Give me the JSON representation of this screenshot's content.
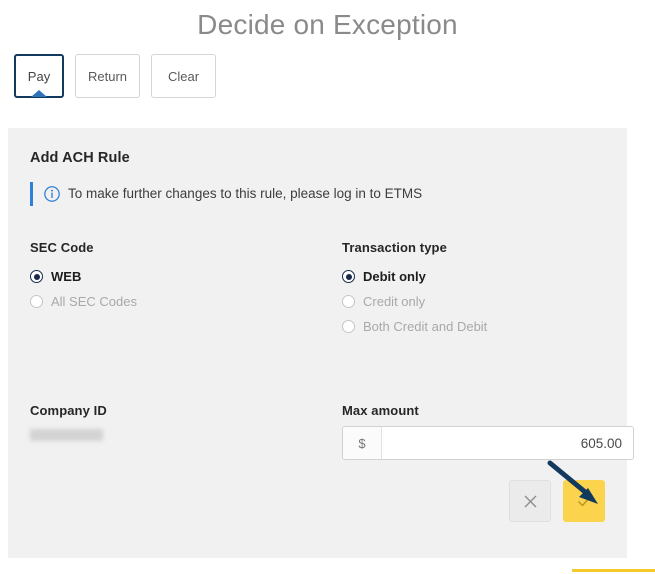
{
  "header": {
    "title": "Decide on Exception"
  },
  "decision_bar": {
    "buttons": [
      {
        "label": "Pay",
        "selected": true
      },
      {
        "label": "Return",
        "selected": false
      },
      {
        "label": "Clear",
        "selected": false
      }
    ]
  },
  "panel": {
    "title": "Add ACH Rule",
    "info": {
      "icon": "info-circle-icon",
      "message": "To make further changes to this rule, please log in to ETMS",
      "accent_color": "#2f80d8"
    },
    "sec_code": {
      "label": "SEC Code",
      "options": [
        {
          "label": "WEB",
          "checked": true,
          "disabled": false
        },
        {
          "label": "All SEC Codes",
          "checked": false,
          "disabled": true
        }
      ]
    },
    "transaction_type": {
      "label": "Transaction type",
      "options": [
        {
          "label": "Debit only",
          "checked": true,
          "disabled": false
        },
        {
          "label": "Credit only",
          "checked": false,
          "disabled": true
        },
        {
          "label": "Both Credit and Debit",
          "checked": false,
          "disabled": true
        }
      ]
    },
    "company_id": {
      "label": "Company ID",
      "value": ""
    },
    "max_amount": {
      "label": "Max amount",
      "currency_symbol": "$",
      "value": "605.00",
      "placeholder": "0.00"
    },
    "actions": {
      "cancel": {
        "icon": "close-x-icon",
        "glyph": "×"
      },
      "confirm": {
        "icon": "checkmark-icon",
        "glyph": "✓",
        "color": "#fcd34d"
      }
    }
  },
  "annotation": {
    "arrow_color": "#12395e",
    "target": "confirm-button"
  },
  "colors": {
    "panel_background": "#f1f1f1",
    "selected_border": "#12395e",
    "radio_selected": "#19294a",
    "accent_yellow": "#fcd34d",
    "bottom_rule": "#f5cb2b"
  }
}
